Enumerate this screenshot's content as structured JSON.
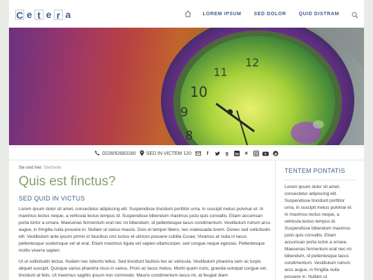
{
  "header": {
    "logo_letters": [
      "C",
      "e",
      "t",
      "e",
      "r",
      "a"
    ],
    "nav_items": [
      "LOREM IPSUM",
      "SED DOLOR",
      "QUID DISTRAM"
    ]
  },
  "contact": {
    "phone": "0228/92683180",
    "address": "SED IN VICTEM 120"
  },
  "main": {
    "breadcrumb_prefix": "Sie sind hier:",
    "breadcrumb_link": "Startseite",
    "title": "Quis est finctus?",
    "subtitle": "SED QUID IN VICTUS",
    "paragraph1": "Lorem ipsum dolor sit amet, consectetur adipiscing elit. Suspendisse tincidunt porttitor urna, in suscipit metus pulvinar et. In maximus lectus neque, a vehicula lectus tempus id. Suspendisse bibendum maximus justo quis convallis. Etiam accumsan porta tortor a ornare. Maecenas fermentum erat nec mi bibendum, id pellentesque lacus condimentum. Vestibulum rutrum arcu augue, in fringilla nulla posuere in. Nullam ut varius mauris. Duis et tempor libero, nec malesuada lorem. Donec sed sollicitudin elit. Vestibulum ante ipsum primis in faucibus orci luctus et ultrices posuere cubilia Curae; Vivamus at nulla in lacus pellentesque scelerisque vel at erat. Etiam maximus ligula vel sapien ullamcorper, sed congue neque egestas. Pellentesque mollis viverra sapien.",
    "paragraph2": "Ut ut sollicitudin lectus. Nullam nec lobortis tellus. Sed tincidunt facilisis leo ac vehicula. Vestibulum pharetra sem ac turpis aliquet suscipit. Quisque varius pharetra risus in varius. Proin ac lacus metus. Morbi quam nunc, gravida volutpat congue vel, tincidunt at felis. Ut maximus sagittis ipsum non commodo. Mauris condimentum lacus mi, at feugiat diam"
  },
  "sidebar": {
    "title": "TENTEM PONTATIS",
    "text": "Lorem ipsum dolor sit amet, consectetur adipiscing elit. Suspendisse tincidunt porttitor urna, in suscipit metus pulvinar et. In maximus lectus neque, a vehicula lectus tempus id. Suspendisse bibendum maximus justo quis convallis. Etiam accumsan porta tortor a ornare. Maecenas fermentum erat nec mi bibendum, id pellentesque lacus condimentum. Vestibulum rutrum arcu augue, in fringilla nulla posuere in. Nullam ut"
  },
  "colors": {
    "brand_blue": "#3f5e8a",
    "title_green": "#8a9e6a",
    "link_green": "#8ba07a"
  },
  "icons": [
    "home-icon",
    "search-icon",
    "phone-icon",
    "location-icon",
    "mail-icon",
    "facebook-icon",
    "twitter-icon",
    "googleplus-icon",
    "linkedin-icon",
    "xing-icon",
    "instagram-icon",
    "youtube-icon",
    "pinterest-icon"
  ]
}
